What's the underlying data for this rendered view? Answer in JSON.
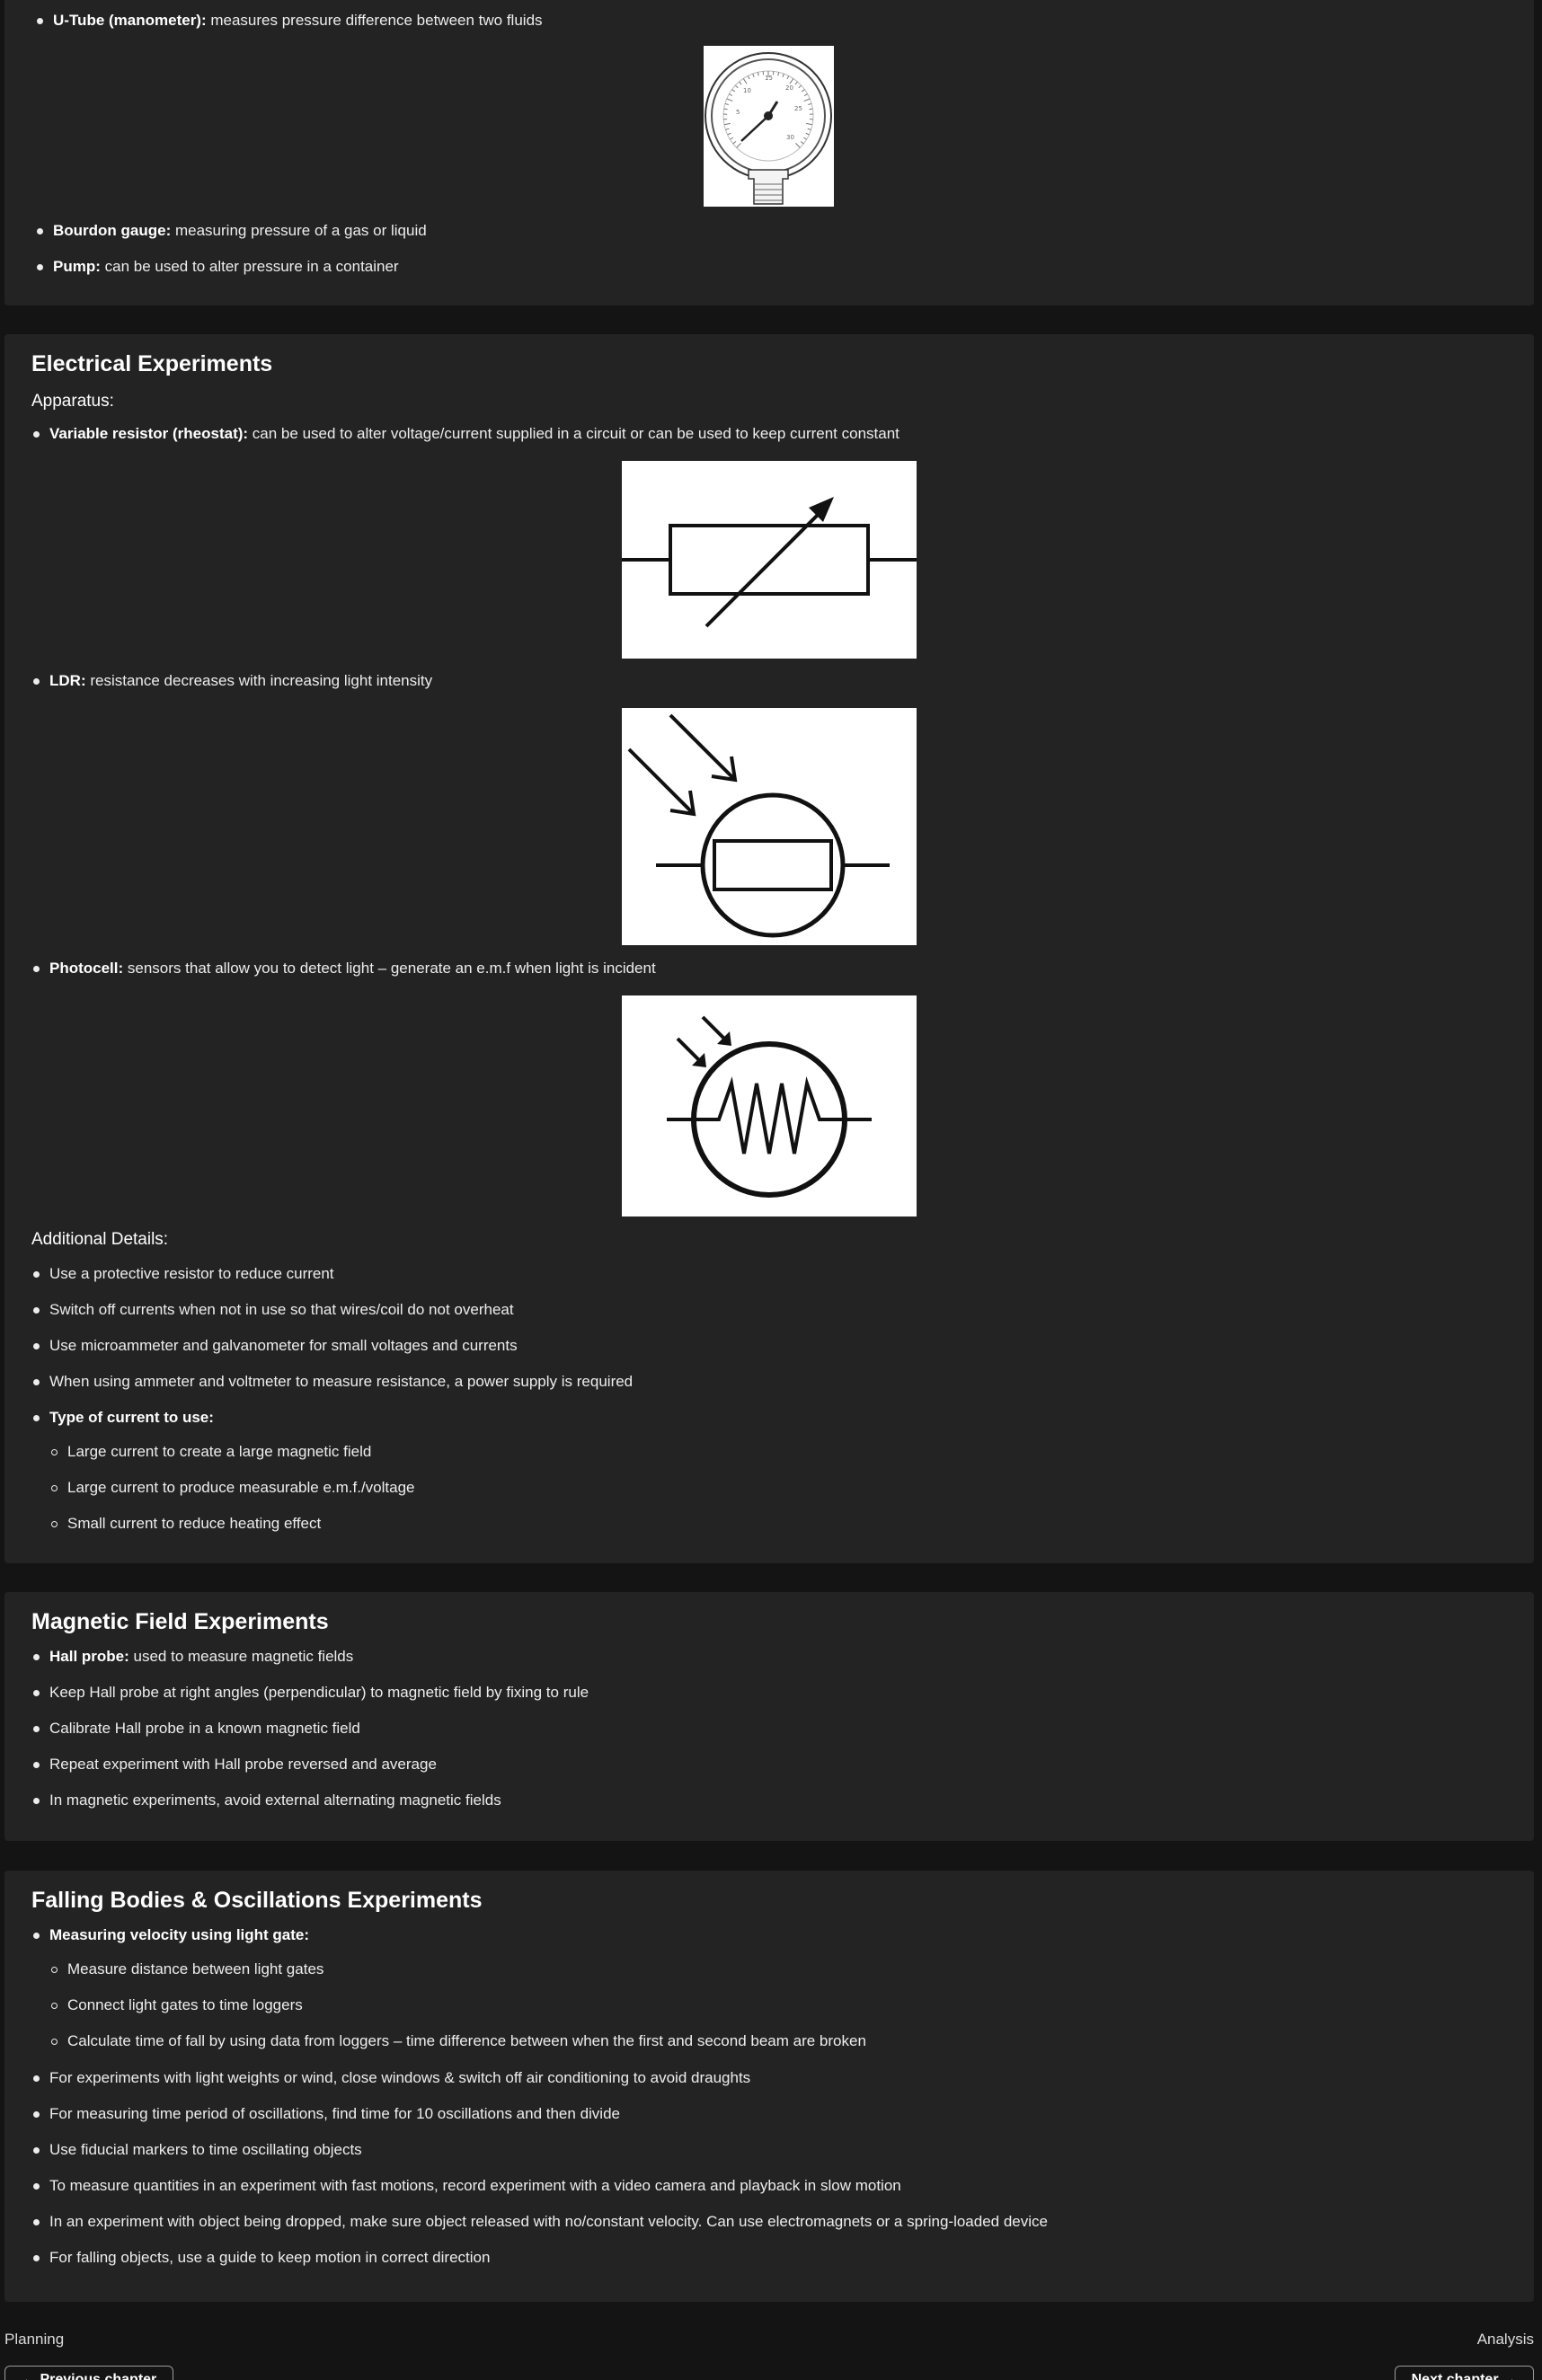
{
  "pressure_section": {
    "items": [
      {
        "bold": "U-Tube (manometer):",
        "text": " measures pressure difference between two fluids"
      },
      {
        "bold": "Bourdon gauge:",
        "text": " measuring pressure of a gas or liquid"
      },
      {
        "bold": "Pump:",
        "text": " can be used to alter pressure in a container"
      }
    ],
    "gauge_dial_numbers": [
      "10",
      "15",
      "20",
      "25",
      "5",
      "30"
    ]
  },
  "electrical_section": {
    "title": "Electrical Experiments",
    "apparatus_heading": "Apparatus:",
    "items": [
      {
        "bold": "Variable resistor (rheostat):",
        "text": " can be used to alter voltage/current supplied in a circuit or can be used to keep current constant"
      },
      {
        "bold": "LDR:",
        "text": " resistance decreases with increasing light intensity"
      },
      {
        "bold": "Photocell:",
        "text": " sensors that allow you to detect light – generate an e.m.f when light is incident"
      }
    ],
    "details_heading": "Additional Details:",
    "details": [
      "Use a protective resistor to reduce current",
      "Switch off currents when not in use so that wires/coil do not overheat",
      "Use microammeter and galvanometer for small voltages and currents",
      "When using ammeter and voltmeter to measure resistance, a power supply is required"
    ],
    "current_type_label": "Type of current to use:",
    "current_types": [
      "Large current to create a large magnetic field",
      "Large current to produce measurable e.m.f./voltage",
      "Small current to reduce heating effect"
    ]
  },
  "magnetic_section": {
    "title": "Magnetic Field Experiments",
    "first": {
      "bold": "Hall probe:",
      "text": " used to measure magnetic fields"
    },
    "items": [
      "Keep Hall probe at right angles (perpendicular) to magnetic field by fixing to rule",
      "Calibrate Hall probe in a known magnetic field",
      "Repeat experiment with Hall probe reversed and average",
      "In magnetic experiments, avoid external alternating magnetic fields"
    ]
  },
  "falling_section": {
    "title": "Falling Bodies & Oscillations Experiments",
    "velocity_label": "Measuring velocity using light gate:",
    "velocity_steps": [
      "Measure distance between light gates",
      "Connect light gates to time loggers",
      "Calculate time of fall by using data from loggers – time difference between when the first and second beam are broken"
    ],
    "items": [
      "For experiments with light weights or wind, close windows & switch off air conditioning to avoid draughts",
      "For measuring time period of oscillations, find time for 10 oscillations and then divide",
      "Use fiducial markers to time oscillating objects",
      "To measure quantities in an experiment with fast motions, record experiment with a video camera and playback in slow motion",
      "In an experiment with object being dropped, make sure object released with no/constant velocity. Can use electromagnets or a spring-loaded device",
      "For falling objects, use a guide to keep motion in correct direction"
    ]
  },
  "footer": {
    "left_link": "Planning",
    "right_link": "Analysis",
    "prev_button": "← Previous chapter",
    "next_button": "Next chapter →"
  }
}
